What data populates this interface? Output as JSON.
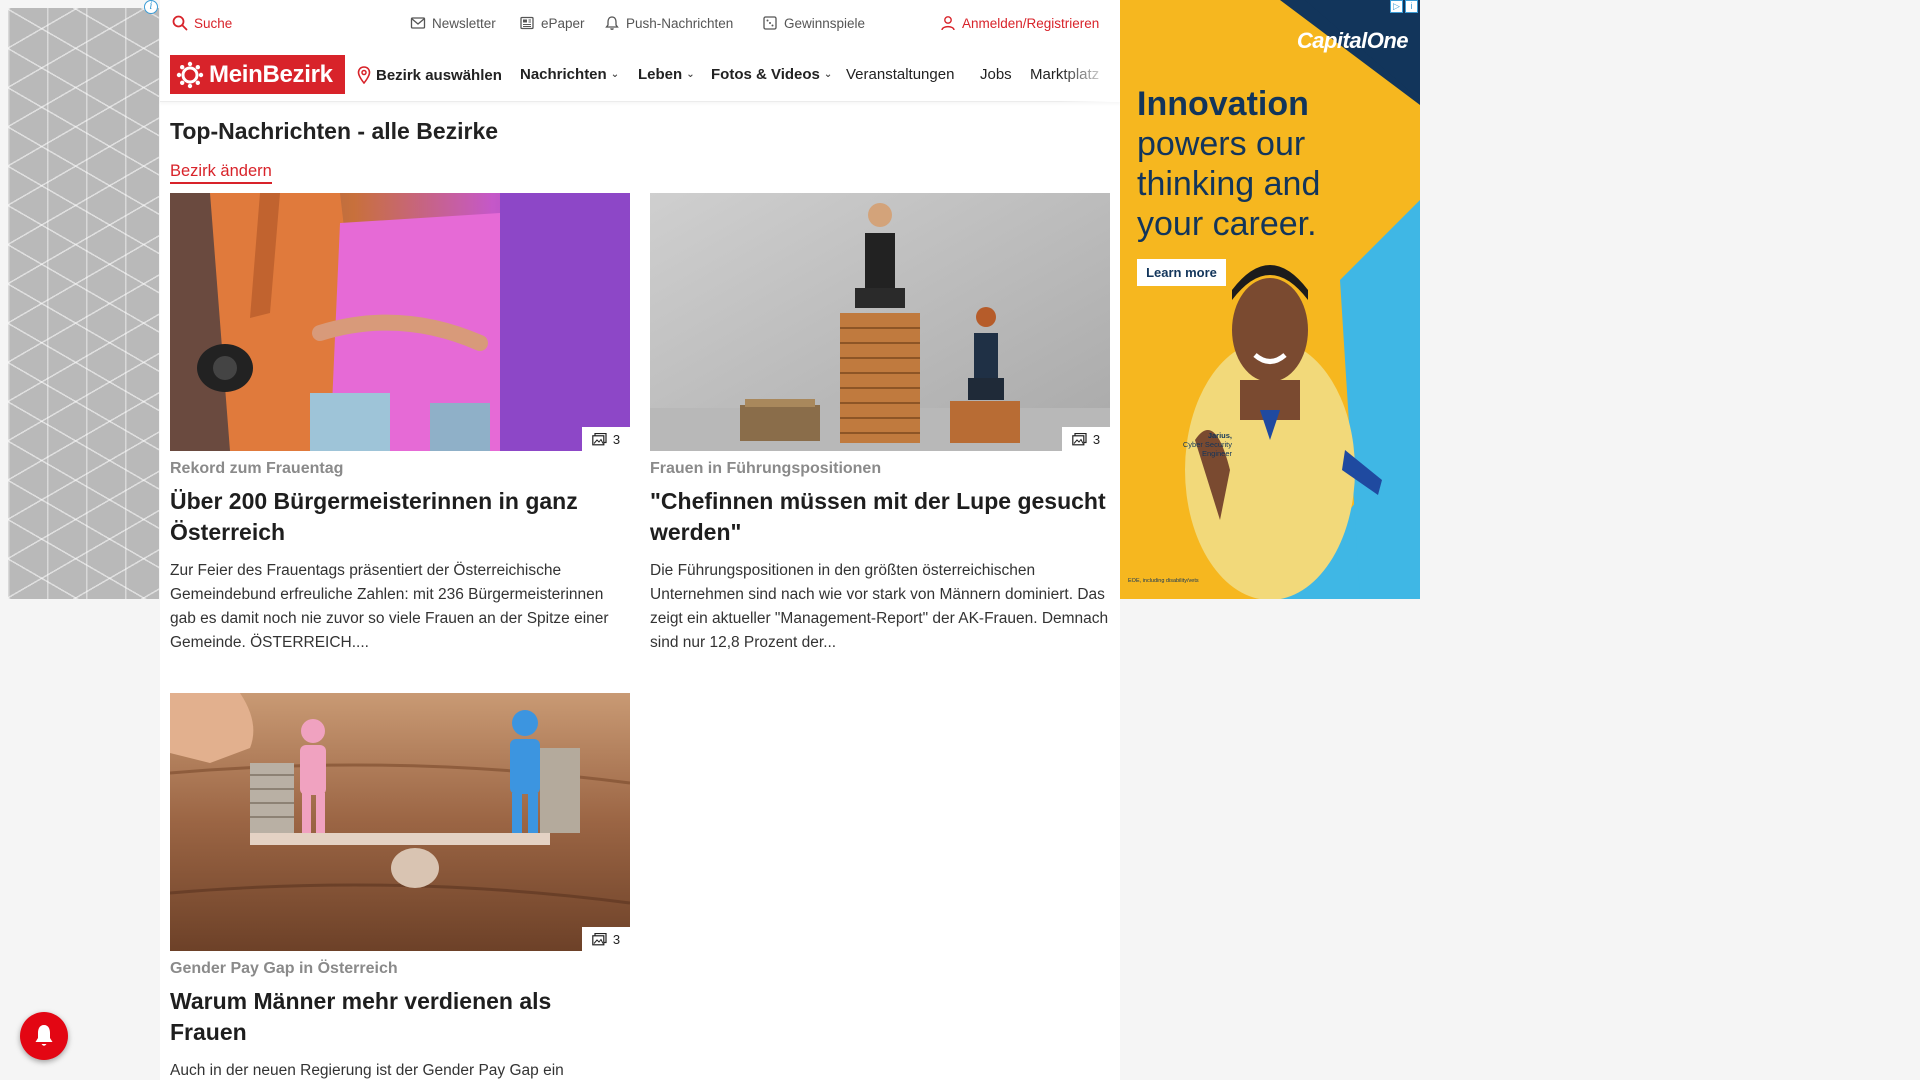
{
  "utility": {
    "search": "Suche",
    "newsletter": "Newsletter",
    "epaper": "ePaper",
    "push": "Push-Nachrichten",
    "gewinnspiele": "Gewinnspiele",
    "login": "Anmelden/Registrieren"
  },
  "nav": {
    "logo": "MeinBezirk",
    "bezirk": "Bezirk auswählen",
    "items": [
      {
        "label": "Nachrichten"
      },
      {
        "label": "Leben"
      },
      {
        "label": "Fotos & Videos"
      },
      {
        "label": "Veranstaltungen"
      },
      {
        "label": "Jobs"
      },
      {
        "label": "Marktplatz"
      }
    ]
  },
  "page": {
    "title": "Top-Nachrichten - alle Bezirke",
    "change_district": "Bezirk ändern"
  },
  "articles": [
    {
      "kicker": "Rekord zum Frauentag",
      "headline": "Über 200 Bürgermeisterinnen in ganz Österreich",
      "teaser": "Zur Feier des Frauentags präsentiert der Österreichische Gemeindebund erfreuliche Zahlen: mit 236 Bürgermeisterinnen gab es damit noch nie zuvor so viele Frauen an der Spitze einer Gemeinde. ÖSTERREICH....",
      "photo_count": "3"
    },
    {
      "kicker": "Frauen in Führungspositionen",
      "headline": "\"Chefinnen müssen mit der Lupe gesucht werden\"",
      "teaser": "Die Führungspositionen in den größten österreichischen Unternehmen sind nach wie vor stark von Männern dominiert. Das zeigt ein aktueller \"Management-Report\" der AK-Frauen. Demnach sind nur 12,8 Prozent der...",
      "photo_count": "3"
    },
    {
      "kicker": "Gender Pay Gap in Österreich",
      "headline": "Warum Männer mehr verdienen als Frauen",
      "teaser": "Auch in der neuen Regierung ist der Gender Pay Gap ein",
      "photo_count": "3"
    }
  ],
  "ad": {
    "brand": "CapitalOne",
    "headline_bold": "Innovation",
    "headline_rest": "powers our thinking and your career.",
    "cta": "Learn more",
    "person_name": "Jarius,",
    "person_role": "Cyber Security Engineer",
    "disclaimer": "EOE, including disability/vets"
  },
  "colors": {
    "brand_red": "#d8232a",
    "ad_yellow": "#f6b71f",
    "ad_navy": "#12355b",
    "ad_cyan": "#3fb7e5"
  },
  "icons": [
    "search-icon",
    "mail-icon",
    "newspaper-icon",
    "bell-icon",
    "gift-icon",
    "user-icon",
    "location-pin-icon",
    "chevron-down-icon",
    "gallery-icon",
    "adchoices-icon",
    "info-icon"
  ]
}
